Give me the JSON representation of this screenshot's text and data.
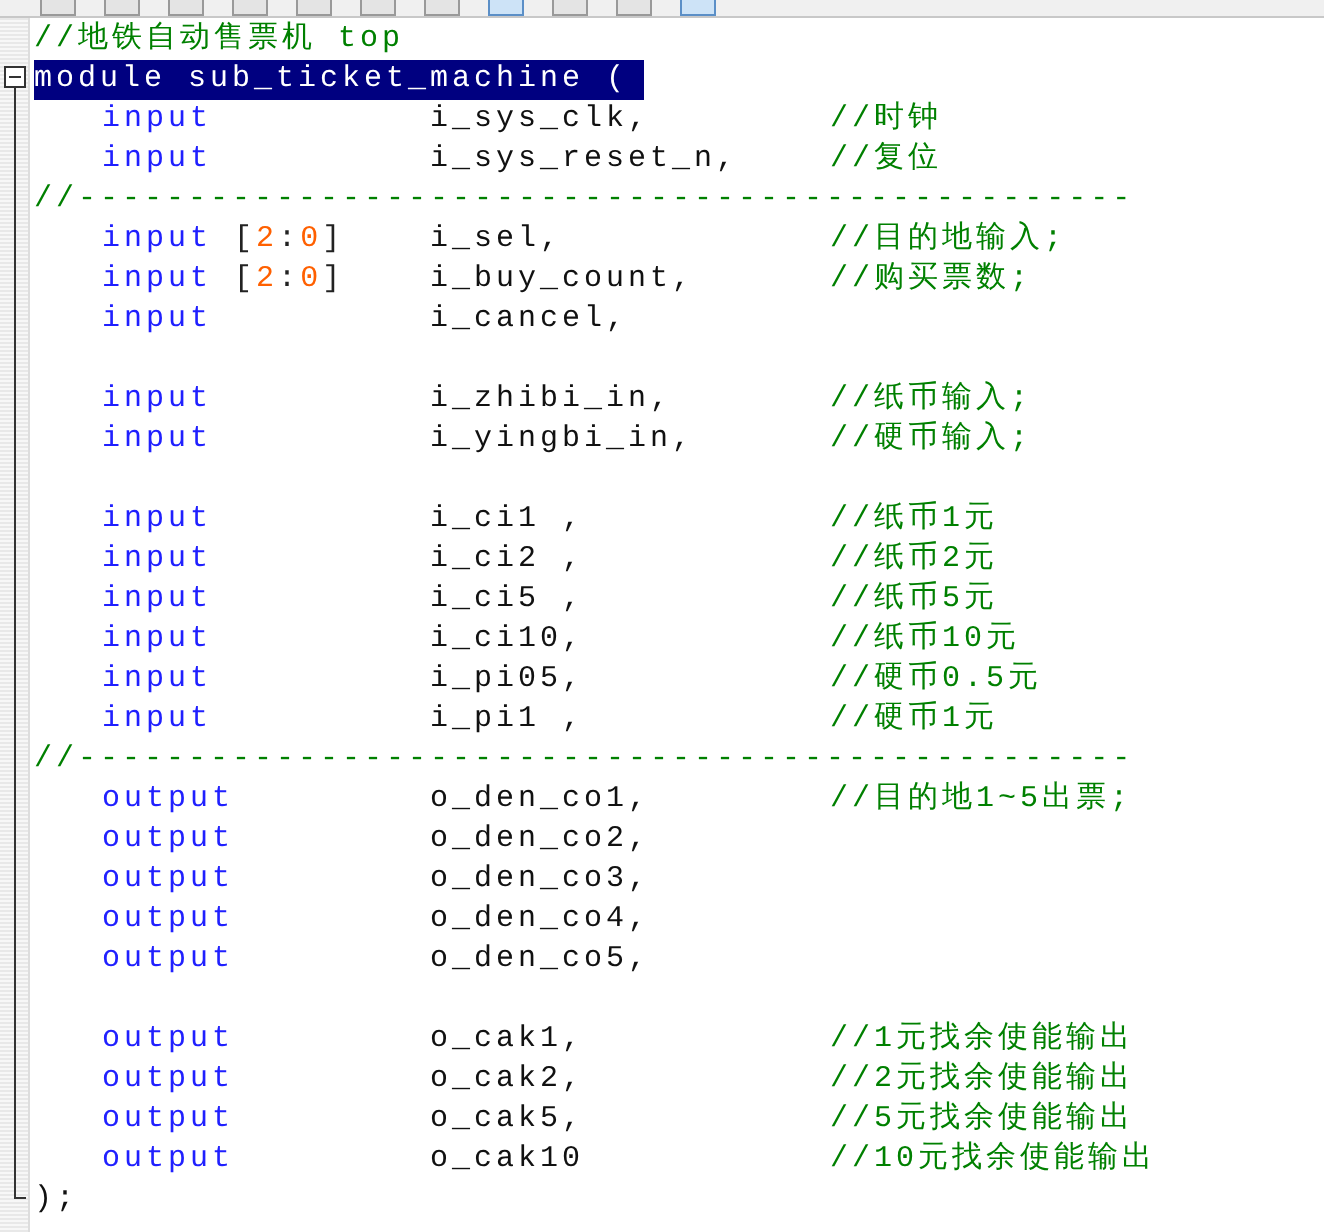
{
  "toolbar": {
    "buttons": [
      {
        "selected": false
      },
      {
        "selected": false
      },
      {
        "selected": false
      },
      {
        "selected": false
      },
      {
        "selected": false
      },
      {
        "selected": false
      },
      {
        "selected": false
      },
      {
        "selected": true
      },
      {
        "selected": false
      },
      {
        "selected": false
      },
      {
        "selected": true
      }
    ]
  },
  "editor": {
    "lines": [
      {
        "kind": "comment",
        "text": "//地铁自动售票机 top"
      },
      {
        "kind": "module",
        "text": "module sub_ticket_machine (",
        "selected": true
      },
      {
        "kind": "port",
        "direction": "input",
        "name": "i_sys_clk,",
        "comment": "//时钟"
      },
      {
        "kind": "port",
        "direction": "input",
        "name": "i_sys_reset_n,",
        "comment": "//复位"
      },
      {
        "kind": "comment",
        "text": "//------------------------------------------------"
      },
      {
        "kind": "port",
        "direction": "input",
        "range": "[2:0]",
        "name": "i_sel,",
        "comment": "//目的地输入;"
      },
      {
        "kind": "port",
        "direction": "input",
        "range": "[2:0]",
        "name": "i_buy_count,",
        "comment": "//购买票数;"
      },
      {
        "kind": "port",
        "direction": "input",
        "name": "i_cancel,"
      },
      {
        "kind": "blank"
      },
      {
        "kind": "port",
        "direction": "input",
        "name": "i_zhibi_in,",
        "comment": "//纸币输入;"
      },
      {
        "kind": "port",
        "direction": "input",
        "name": "i_yingbi_in,",
        "comment": "//硬币输入;"
      },
      {
        "kind": "blank"
      },
      {
        "kind": "port",
        "direction": "input",
        "name": "i_ci1 ,",
        "comment": "//纸币1元"
      },
      {
        "kind": "port",
        "direction": "input",
        "name": "i_ci2 ,",
        "comment": "//纸币2元"
      },
      {
        "kind": "port",
        "direction": "input",
        "name": "i_ci5 ,",
        "comment": "//纸币5元"
      },
      {
        "kind": "port",
        "direction": "input",
        "name": "i_ci10,",
        "comment": "//纸币10元"
      },
      {
        "kind": "port",
        "direction": "input",
        "name": "i_pi05,",
        "comment": "//硬币0.5元"
      },
      {
        "kind": "port",
        "direction": "input",
        "name": "i_pi1 ,",
        "comment": "//硬币1元"
      },
      {
        "kind": "comment",
        "text": "//------------------------------------------------"
      },
      {
        "kind": "port",
        "direction": "output",
        "name": "o_den_co1,",
        "comment": "//目的地1~5出票;"
      },
      {
        "kind": "port",
        "direction": "output",
        "name": "o_den_co2,"
      },
      {
        "kind": "port",
        "direction": "output",
        "name": "o_den_co3,"
      },
      {
        "kind": "port",
        "direction": "output",
        "name": "o_den_co4,"
      },
      {
        "kind": "port",
        "direction": "output",
        "name": "o_den_co5,"
      },
      {
        "kind": "blank"
      },
      {
        "kind": "port",
        "direction": "output",
        "name": "o_cak1,",
        "comment": "//1元找余使能输出"
      },
      {
        "kind": "port",
        "direction": "output",
        "name": "o_cak2,",
        "comment": "//2元找余使能输出"
      },
      {
        "kind": "port",
        "direction": "output",
        "name": "o_cak5,",
        "comment": "//5元找余使能输出"
      },
      {
        "kind": "port",
        "direction": "output",
        "name": "o_cak10",
        "comment": "//10元找余使能输出"
      },
      {
        "kind": "close",
        "text": ");"
      }
    ]
  }
}
